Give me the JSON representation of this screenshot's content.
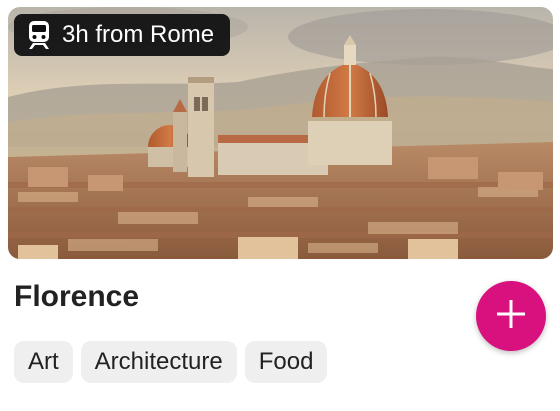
{
  "card": {
    "badge": {
      "icon": "train-icon",
      "text": "3h from Rome"
    },
    "title": "Florence",
    "add_button": {
      "icon": "plus-icon"
    },
    "tags": [
      "Art",
      "Architecture",
      "Food"
    ],
    "colors": {
      "accent": "#d9117f",
      "badge_bg": "#0c0c0e",
      "tag_bg": "#efefef"
    }
  }
}
